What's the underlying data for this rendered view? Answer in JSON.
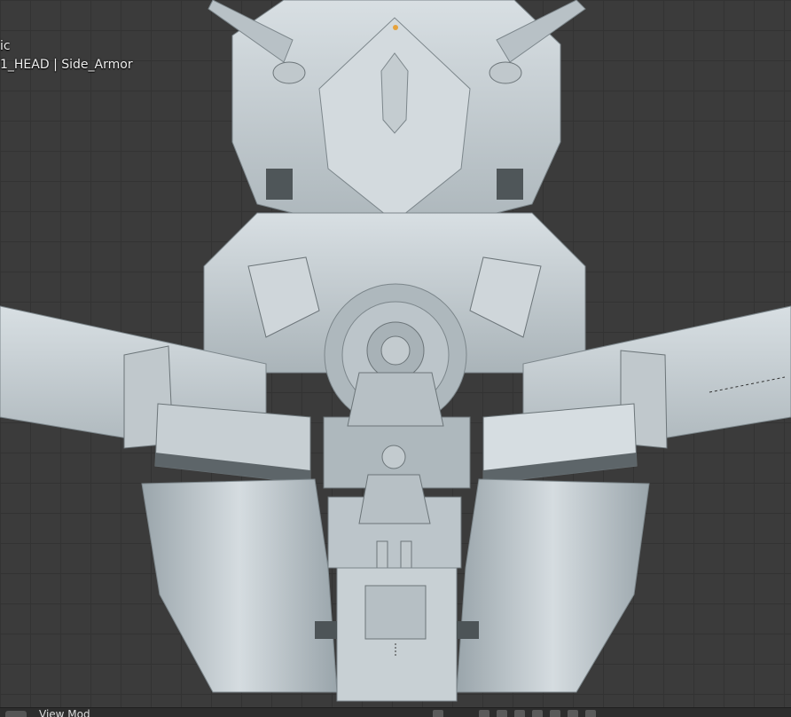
{
  "viewport": {
    "view_name": "ic",
    "object_name": "1_HEAD | Side_Armor"
  },
  "footer": {
    "menu_label": "View   Mod"
  },
  "colors": {
    "background": "#3b3b3b",
    "grid": "#333333",
    "model": "#c9d2d6",
    "model_dark": "#8f9aa0",
    "shadow": "#5d6569",
    "origin": "#e6a23c"
  }
}
